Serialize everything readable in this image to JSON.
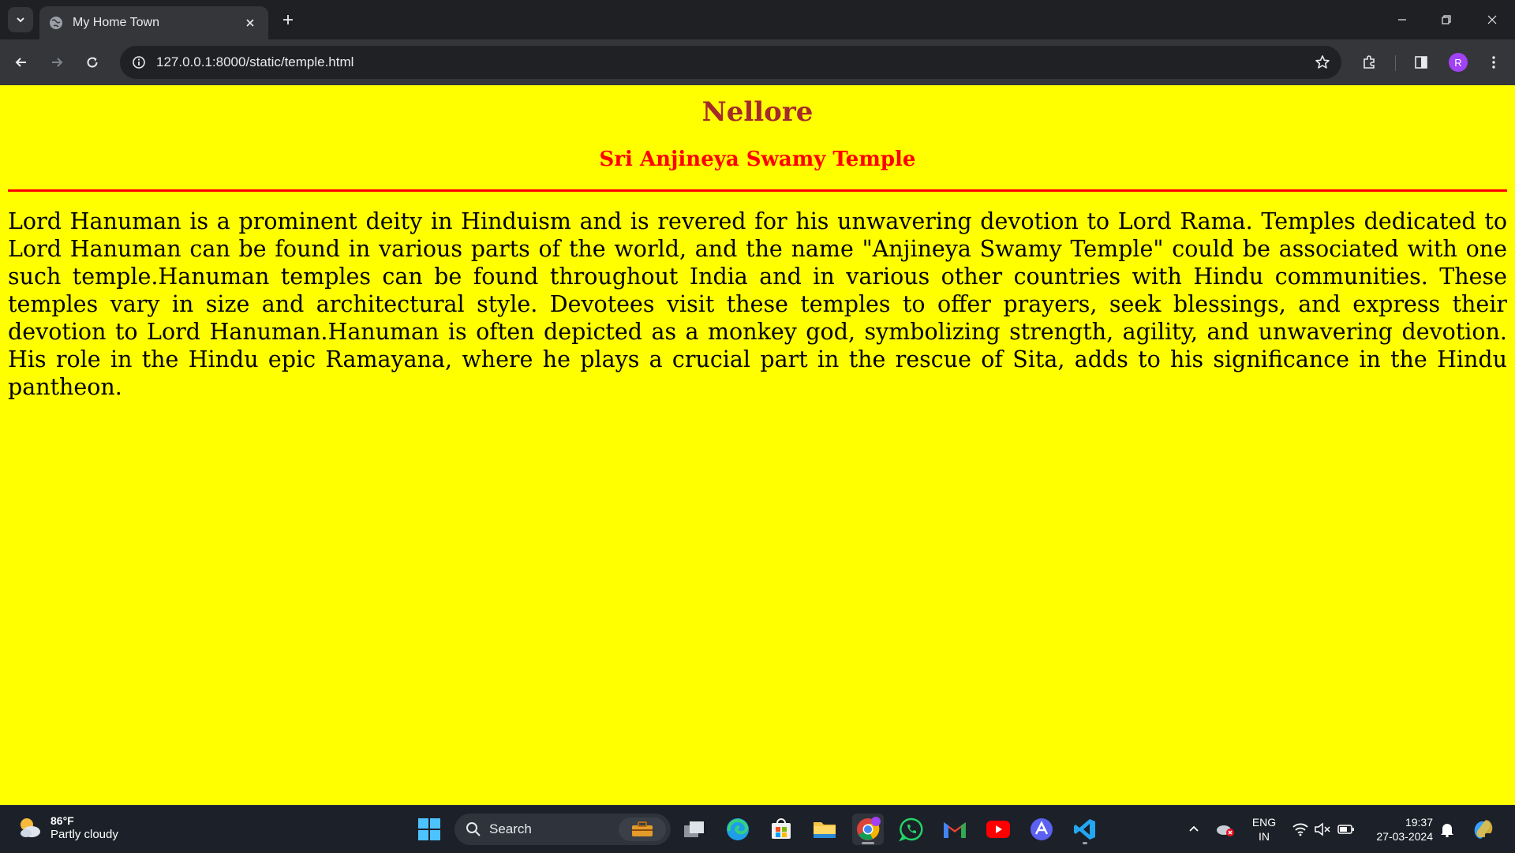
{
  "browser": {
    "tab": {
      "title": "My Home Town"
    },
    "address_bar": {
      "url": "127.0.0.1:8000/static/temple.html"
    },
    "profile_initial": "R"
  },
  "page": {
    "heading": "Nellore",
    "subheading": "Sri Anjineya Swamy Temple",
    "paragraph": "Lord Hanuman is a prominent deity in Hinduism and is revered for his unwavering devotion to Lord Rama. Temples dedicated to Lord Hanuman can be found in various parts of the world, and the name \"Anjineya Swamy Temple\" could be associated with one such temple.Hanuman temples can be found throughout India and in various other countries with Hindu communities. These temples vary in size and architectural style. Devotees visit these temples to offer prayers, seek blessings, and express their devotion to Lord Hanuman.Hanuman is often depicted as a monkey god, symbolizing strength, agility, and unwavering devotion. His role in the Hindu epic Ramayana, where he plays a crucial part in the rescue of Sita, adds to his significance in the Hindu pantheon.",
    "colors": {
      "background": "#ffff00",
      "heading": "#a52a2a",
      "subheading": "#ff0000",
      "rule": "#ff0000"
    }
  },
  "taskbar": {
    "weather": {
      "temperature": "86°F",
      "condition": "Partly cloudy"
    },
    "search_label": "Search",
    "apps": [
      "windows-start",
      "search",
      "task-view",
      "edge",
      "microsoft-store",
      "file-explorer",
      "chrome",
      "whatsapp",
      "gmail",
      "youtube",
      "arc",
      "vscode"
    ],
    "language": {
      "line1": "ENG",
      "line2": "IN"
    },
    "clock": {
      "time": "19:37",
      "date": "27-03-2024"
    }
  }
}
